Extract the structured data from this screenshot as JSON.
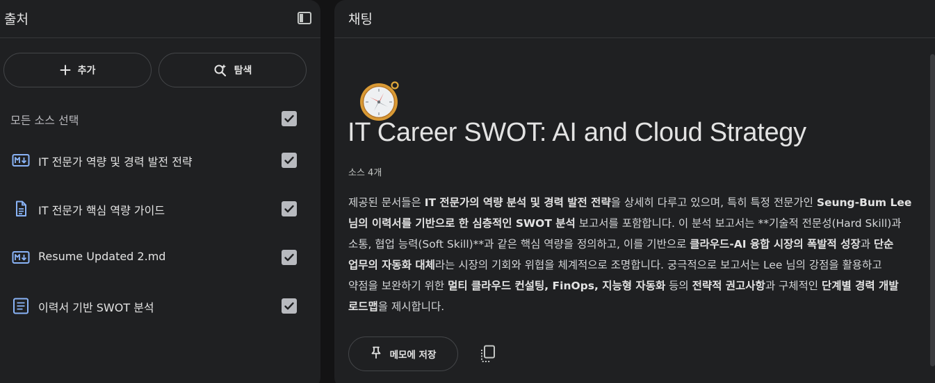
{
  "sources_panel": {
    "title": "출처",
    "add_label": "추가",
    "discover_label": "탐색",
    "select_all_label": "모든 소스 선택",
    "items": [
      {
        "label": "IT 전문가 역량 및 경력 발전 전략",
        "icon": "markdown-file-icon",
        "checked": true
      },
      {
        "label": "IT 전문가 핵심 역량 가이드",
        "icon": "document-icon",
        "checked": true
      },
      {
        "label": "Resume Updated 2.md",
        "icon": "markdown-file-icon",
        "checked": true
      },
      {
        "label": "이력서 기반 SWOT 분석",
        "icon": "notes-icon",
        "checked": true
      }
    ]
  },
  "chat_panel": {
    "title": "채팅",
    "notebook_emoji": "compass-icon",
    "notebook_title": "IT Career SWOT: AI and Cloud Strategy",
    "source_count": "소스 4개",
    "summary": {
      "s1": "제공된 문서들은 ",
      "b1": "IT 전문가의 역량 분석 및 경력 발전 전략",
      "s2": "을 상세히 다루고 있으며, 특히 특정 전문가인 ",
      "b2": "Seung-Bum Lee 님의 이력서를 기반으로 한 심층적인 SWOT 분석",
      "s3": " 보고서를 포함합니다. 이 분석 보고서는 **기술적 전문성(Hard Skill)과 소통, 협업 능력(Soft Skill)**과 같은 핵심 역량을 정의하고, 이를 기반으로 ",
      "b3": "클라우드-AI 융합 시장의 폭발적 성장",
      "s4": "과 ",
      "b4": "단순 업무의 자동화 대체",
      "s5": "라는 시장의 기회와 위협을 체계적으로 조명합니다. 궁극적으로 보고서는 Lee 님의 강점을 활용하고 약점을 보완하기 위한 ",
      "b5": "멀티 클라우드 컨설팅, FinOps, 지능형 자동화",
      "s6": " 등의 ",
      "b6": "전략적 권고사항",
      "s7": "과 구체적인 ",
      "b7": "단계별 경력 개발 로드맵",
      "s8": "을 제시합니다."
    },
    "save_to_note_label": "메모에 저장"
  },
  "colors": {
    "background": "#131314",
    "panel": "#1f2022",
    "checkbox": "#b8babf",
    "icon_blue": "#8ab4f8"
  }
}
